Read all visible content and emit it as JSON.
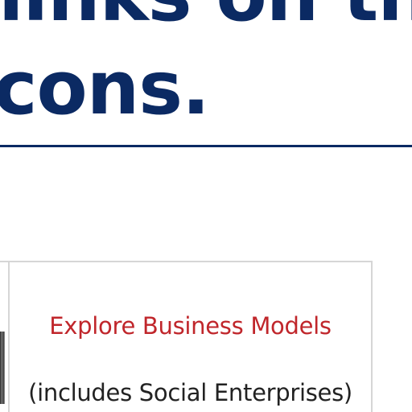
{
  "heading": {
    "line1": "links on th",
    "line2": "cons."
  },
  "table": {
    "cell": {
      "link_label": "Explore Business Models",
      "subtext": "(includes Social Enterprises)"
    }
  },
  "colors": {
    "heading": "#0b2a63",
    "link": "#c0262b",
    "border": "#d6d6d6"
  }
}
